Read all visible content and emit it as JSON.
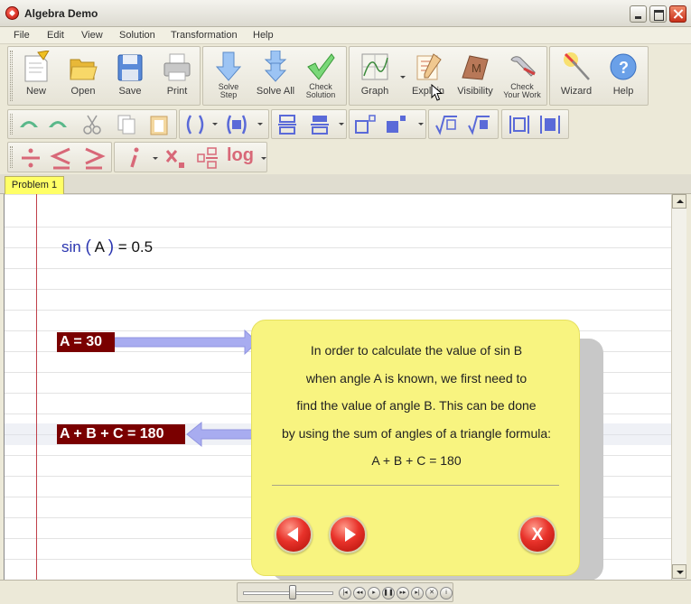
{
  "window": {
    "title": "Algebra Demo"
  },
  "menu": [
    "File",
    "Edit",
    "View",
    "Solution",
    "Transformation",
    "Help"
  ],
  "toolbar_main": {
    "file_buttons": [
      {
        "label": "New",
        "icon": "new-document-icon"
      },
      {
        "label": "Open",
        "icon": "folder-open-icon"
      },
      {
        "label": "Save",
        "icon": "floppy-disk-icon"
      },
      {
        "label": "Print",
        "icon": "printer-icon"
      }
    ],
    "solve_buttons": [
      {
        "label": "Solve\nStep",
        "icon": "arrow-down-icon"
      },
      {
        "label": "Solve All",
        "icon": "double-arrow-down-icon"
      },
      {
        "label": "Check\nSolution",
        "icon": "checkmark-icon"
      }
    ],
    "tool_buttons": [
      {
        "label": "Graph",
        "icon": "graph-icon"
      },
      {
        "label": "Explain",
        "icon": "explain-notepad-icon"
      },
      {
        "label": "Visibility",
        "icon": "visibility-icon"
      },
      {
        "label": "Check\nYour Work",
        "icon": "wrench-icon"
      }
    ],
    "help_buttons": [
      {
        "label": "Wizard",
        "icon": "wizard-wand-icon"
      },
      {
        "label": "Help",
        "icon": "help-question-icon"
      }
    ]
  },
  "toolbar_math": {
    "log_label": "log"
  },
  "tabs": [
    {
      "label": "Problem 1"
    }
  ],
  "worksheet": {
    "equation": {
      "fn": "sin",
      "arg": "A",
      "rhs": "= 0.5"
    },
    "label_a": "A = 30",
    "label_sum": "A + B + C = 180"
  },
  "popup": {
    "lines": [
      "In order to calculate the value of sin B",
      "when angle A is known, we first need to",
      "find the value of angle B. This can be done",
      "by using the sum of angles of a triangle formula:",
      "A + B + C = 180"
    ],
    "close_label": "X",
    "prev_icon": "arrow-left-icon",
    "next_icon": "arrow-right-icon"
  },
  "player": {
    "slider_position": 0.55
  },
  "colors": {
    "accent_red": "#7a0000",
    "popup_yellow": "#f8f480",
    "arrow_blue": "#a8acf0",
    "tab_yellow": "#ffff66"
  }
}
